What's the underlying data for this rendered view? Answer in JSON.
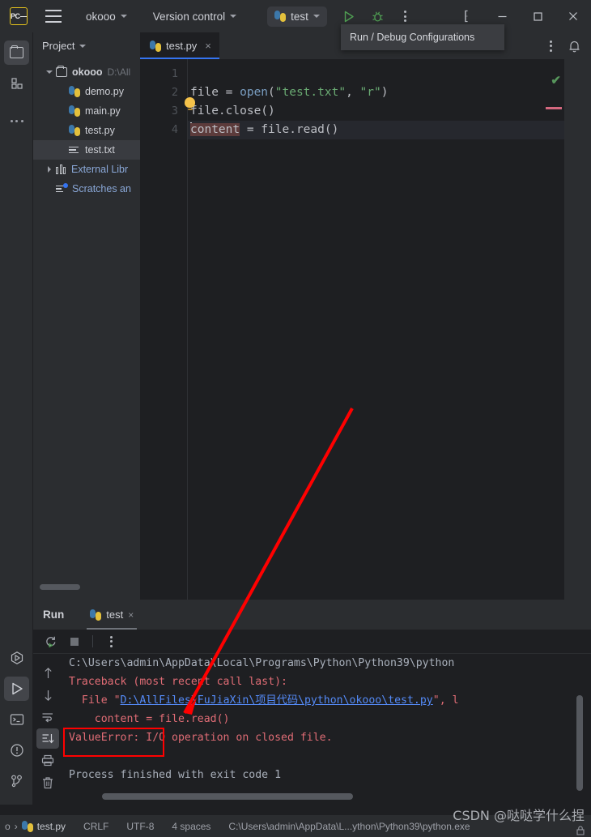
{
  "titlebar": {
    "logo": "pycharm-logo",
    "project_name": "okooo",
    "vcs_label": "Version control",
    "run_config": "test",
    "tooltip": "Run / Debug Configurations",
    "icons": {
      "hamburger": "hamburger-menu-icon",
      "run": "run-icon",
      "debug": "debug-icon",
      "more": "more-options-icon",
      "search": "search-icon",
      "minimize": "minimize-icon",
      "maximize": "maximize-icon",
      "close": "close-icon"
    }
  },
  "activitybar": {
    "top_items": [
      "project-icon",
      "structure-icon",
      "more-tool-windows-icon"
    ],
    "bottom_items": [
      "debug-icon",
      "run-icon",
      "terminal-icon",
      "problems-icon",
      "version-control-icon"
    ]
  },
  "project_panel": {
    "title": "Project",
    "tree": [
      {
        "label": "okooo",
        "sub": "D:\\All",
        "icon": "folder-icon",
        "expanded": true,
        "depth": 0,
        "selected": false
      },
      {
        "label": "demo.py",
        "sub": "",
        "icon": "python-file-icon",
        "depth": 1,
        "selected": false
      },
      {
        "label": "main.py",
        "sub": "",
        "icon": "python-file-icon",
        "depth": 1,
        "selected": false
      },
      {
        "label": "test.py",
        "sub": "",
        "icon": "python-file-icon",
        "depth": 1,
        "selected": false
      },
      {
        "label": "test.txt",
        "sub": "",
        "icon": "text-file-icon",
        "depth": 1,
        "selected": true
      },
      {
        "label": "External Libr",
        "sub": "",
        "icon": "library-icon",
        "collapsed": true,
        "depth": 0,
        "selected": false
      },
      {
        "label": "Scratches an",
        "sub": "",
        "icon": "scratches-icon",
        "depth": 0,
        "selected": false
      }
    ]
  },
  "editor": {
    "tab": {
      "label": "test.py",
      "icon": "python-file-icon",
      "close": "×"
    },
    "inspection_status": "✔",
    "lines": [
      {
        "num": "1",
        "text": ""
      },
      {
        "num": "2",
        "text": "file = open(\"test.txt\", \"r\")"
      },
      {
        "num": "3",
        "text": "file.close()"
      },
      {
        "num": "4",
        "text": "content = file.read()"
      }
    ],
    "current_line": 4,
    "bulb": "intention-bulb-icon"
  },
  "run_panel": {
    "title": "Run",
    "tab": {
      "label": "test",
      "icon": "python-file-icon",
      "close": "×"
    },
    "toolbar": [
      "rerun-icon",
      "stop-icon",
      "more-options-icon"
    ],
    "side_tools": [
      "scroll-up-icon",
      "scroll-down-icon",
      "soft-wrap-icon",
      "scroll-to-end-icon",
      "print-icon",
      "clear-all-icon"
    ],
    "console": {
      "cmdline": "C:\\Users\\admin\\AppData\\Local\\Programs\\Python\\Python39\\python",
      "traceback_header": "Traceback (most recent call last):",
      "file_prefix": "  File \"",
      "file_link": "D:\\AllFiles\\FuJiaXin\\项目代码\\python\\okooo\\test.py",
      "file_suffix": "\", l",
      "code_line": "    content = file.read()",
      "error_name": "ValueError:",
      "error_msg": " I/O operation on closed file.",
      "exit_line": "Process finished with exit code 1"
    }
  },
  "annotation": {
    "box_label": "error-highlight-box",
    "arrow_label": "red-arrow-annotation",
    "color": "#ff0000"
  },
  "statusbar": {
    "crumb_prefix": "o",
    "crumb_sep": "›",
    "file": "test.py",
    "line_sep": "CRLF",
    "encoding": "UTF-8",
    "indent": "4 spaces",
    "interpreter": "C:\\Users\\admin\\AppData\\L...ython\\Python39\\python.exe"
  },
  "watermark": {
    "text": "CSDN @哒哒学什么捏"
  },
  "colors": {
    "bg": "#1e1f22",
    "panel": "#2b2d30",
    "accent": "#3574f0",
    "error": "#e06c75",
    "link": "#548af7",
    "annotation": "#ff0000",
    "string": "#6aab73",
    "keyword": "#cf8e6d"
  }
}
